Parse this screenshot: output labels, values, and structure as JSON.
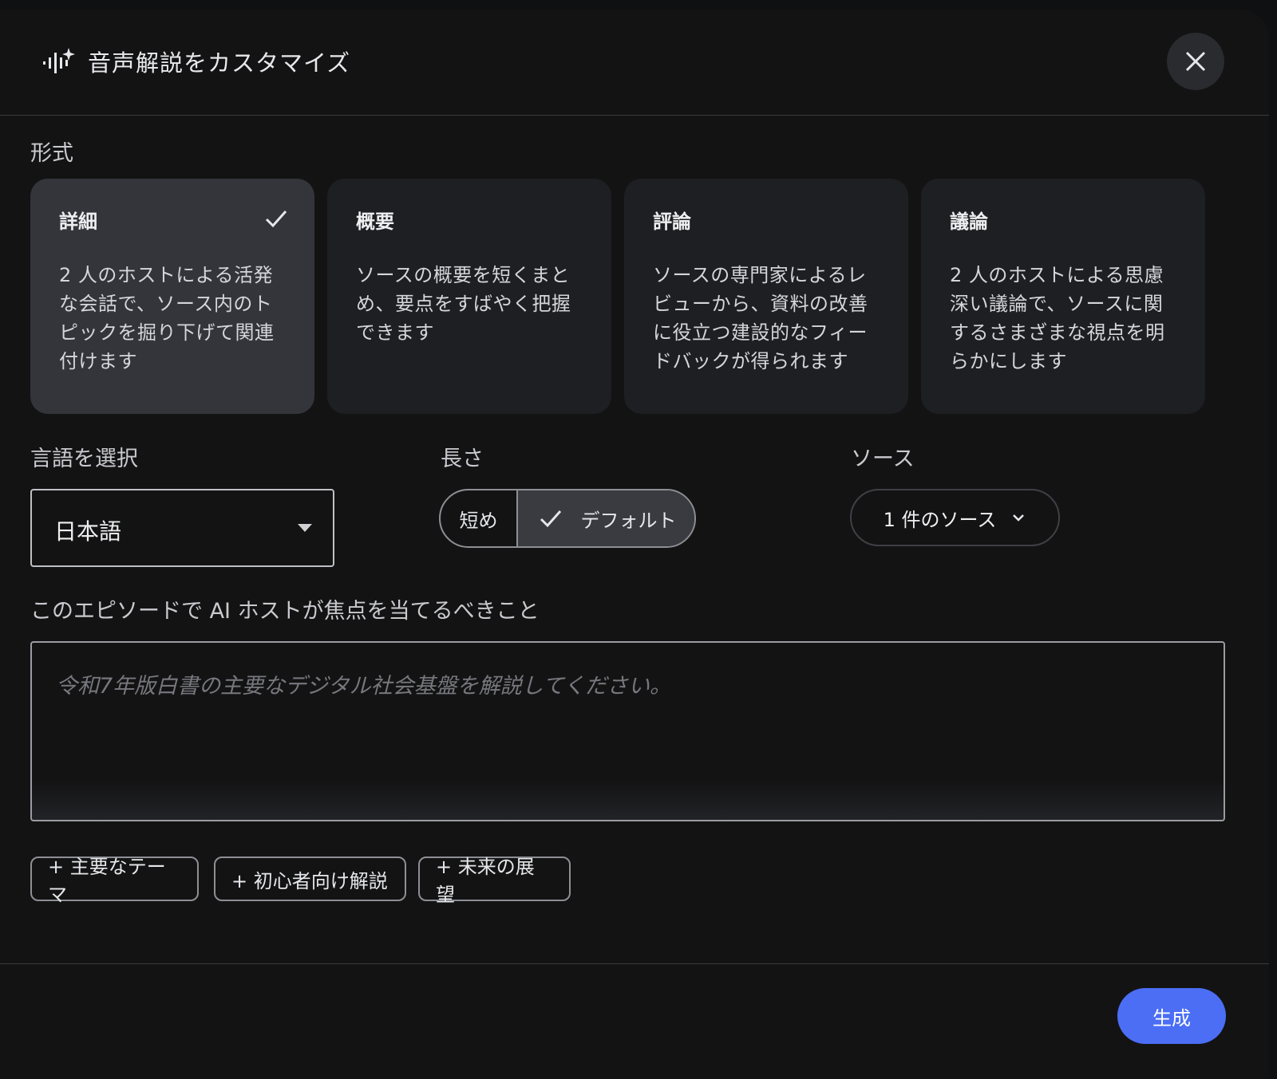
{
  "dialog": {
    "title": "音声解説をカスタマイズ"
  },
  "format": {
    "label": "形式",
    "cards": [
      {
        "title": "詳細",
        "desc": "2 人のホストによる活発な会話で、ソース内のトピックを掘り下げて関連付けます",
        "selected": true
      },
      {
        "title": "概要",
        "desc": "ソースの概要を短くまとめ、要点をすばやく把握できます",
        "selected": false
      },
      {
        "title": "評論",
        "desc": "ソースの専門家によるレビューから、資料の改善に役立つ建設的なフィードバックが得られます",
        "selected": false
      },
      {
        "title": "議論",
        "desc": "2 人のホストによる思慮深い議論で、ソースに関するさまざまな視点を明らかにします",
        "selected": false
      }
    ]
  },
  "language": {
    "label": "言語を選択",
    "value": "日本語"
  },
  "length": {
    "label": "長さ",
    "options": [
      "短め",
      "デフォルト"
    ],
    "selected": "デフォルト"
  },
  "sources": {
    "label": "ソース",
    "value": "1 件のソース"
  },
  "focus": {
    "label": "このエピソードで AI ホストが焦点を当てるべきこと",
    "placeholder": "令和7年版白書の主要なデジタル社会基盤を解説してください。"
  },
  "chips": [
    "+ 主要なテーマ",
    "+ 初心者向け解説",
    "+ 未来の展望"
  ],
  "actions": {
    "generate": "生成"
  },
  "colors": {
    "accent": "#4b6ef5",
    "selected_card": "#34353a",
    "card": "#1e1f22",
    "background": "#131314"
  },
  "icons": {
    "header": "audio-sparkle-icon",
    "close": "close-icon",
    "check": "check-icon",
    "dropdown": "chevron-down-icon"
  }
}
